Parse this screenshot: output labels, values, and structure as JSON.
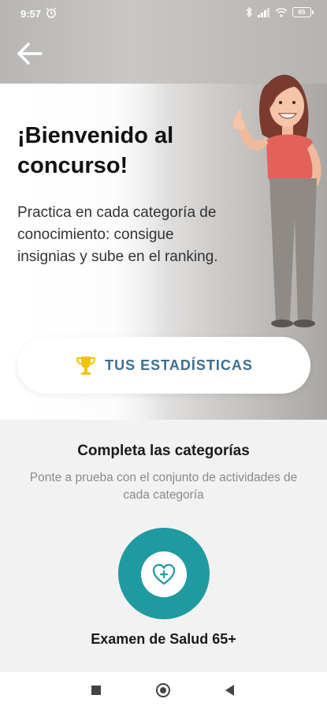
{
  "status_bar": {
    "time": "9:57",
    "battery": "65",
    "icons": [
      "alarm-icon",
      "bluetooth-icon",
      "signal-icon",
      "wifi-icon",
      "battery-icon"
    ]
  },
  "header": {
    "back_icon": "arrow-left-icon"
  },
  "hero": {
    "title": "¡Bienvenido al concurso!",
    "description": "Practica en cada categoría de conocimiento: consigue insignias y sube en el ranking."
  },
  "stats_button": {
    "label": "TUS ESTADÍSTICAS",
    "icon": "trophy-icon"
  },
  "categories_section": {
    "title": "Completa las categorías",
    "subtitle": "Ponte a prueba con el conjunto de actividades de cada categoría",
    "items": [
      {
        "label": "Examen de Salud 65+",
        "icon": "heart-plus-icon"
      }
    ]
  },
  "nav_bar": {
    "icons": [
      "recent-apps-icon",
      "home-icon",
      "back-icon"
    ]
  },
  "colors": {
    "accent_teal": "#1f9aa1",
    "stats_text": "#3c6e8f",
    "trophy": "#f2c300"
  }
}
